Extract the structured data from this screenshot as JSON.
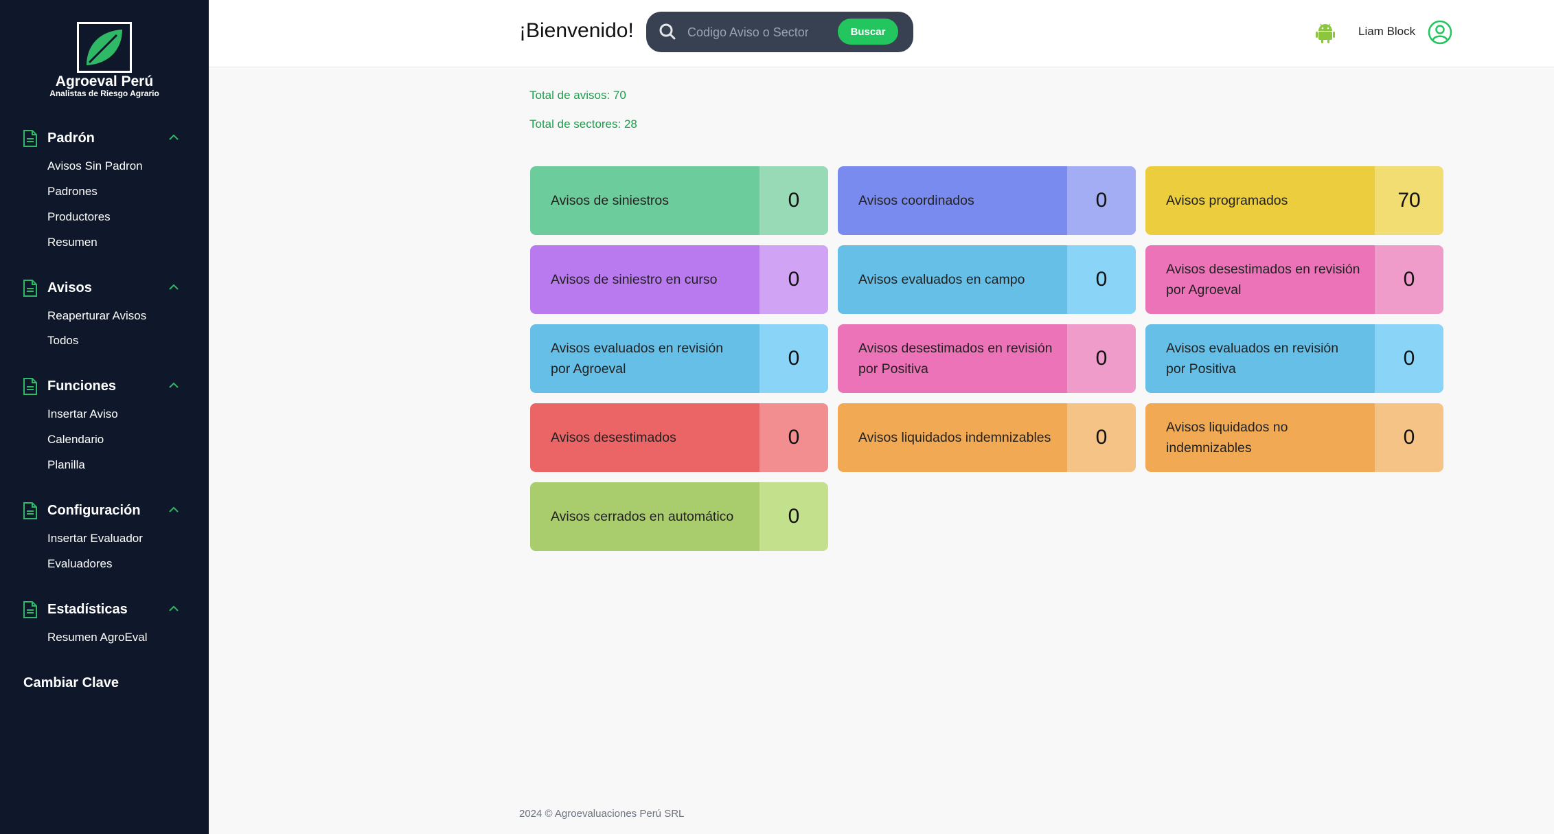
{
  "brand": {
    "name": "Agroeval Perú",
    "tagline": "Analistas de Riesgo Agrario"
  },
  "sidebar": {
    "sections": [
      {
        "title": "Padrón",
        "items": [
          "Avisos Sin Padron",
          "Padrones",
          "Productores",
          "Resumen"
        ]
      },
      {
        "title": "Avisos",
        "items": [
          "Reaperturar Avisos",
          "Todos"
        ]
      },
      {
        "title": "Funciones",
        "items": [
          "Insertar Aviso",
          "Calendario",
          "Planilla"
        ]
      },
      {
        "title": "Configuración",
        "items": [
          "Insertar Evaluador",
          "Evaluadores"
        ]
      },
      {
        "title": "Estadísticas",
        "items": [
          "Resumen AgroEval"
        ]
      }
    ],
    "cambiar_clave": "Cambiar Clave"
  },
  "header": {
    "welcome": "¡Bienvenido!",
    "search_placeholder": "Codigo Aviso o Sector",
    "search_button": "Buscar",
    "user_name": "Liam Block"
  },
  "totals": {
    "avisos": "Total de avisos: 70",
    "sectores": "Total de sectores: 28"
  },
  "cards": [
    {
      "label": "Avisos de siniestros",
      "count": "0",
      "color": "#6dcc9b",
      "count_color": "#98dab6"
    },
    {
      "label": "Avisos coordinados",
      "count": "0",
      "color": "#7a8bef",
      "count_color": "#a2adf4"
    },
    {
      "label": "Avisos programados",
      "count": "70",
      "color": "#eccd3d",
      "count_color": "#f2dd73"
    },
    {
      "label": "Avisos de siniestro en curso",
      "count": "0",
      "color": "#b97aef",
      "count_color": "#d0a3f4"
    },
    {
      "label": "Avisos evaluados en campo",
      "count": "0",
      "color": "#66bfe6",
      "count_color": "#8ad5f7"
    },
    {
      "label": "Avisos desestimados en revisión por Agroeval",
      "count": "0",
      "color": "#ec73b8",
      "count_color": "#f09ccb"
    },
    {
      "label": "Avisos evaluados en revisión por Agroeval",
      "count": "0",
      "color": "#66bfe6",
      "count_color": "#8ad5f7"
    },
    {
      "label": "Avisos desestimados en revisión por Positiva",
      "count": "0",
      "color": "#ec73b8",
      "count_color": "#f09ccb"
    },
    {
      "label": "Avisos evaluados en revisión por Positiva",
      "count": "0",
      "color": "#66bfe6",
      "count_color": "#8ad5f7"
    },
    {
      "label": "Avisos desestimados",
      "count": "0",
      "color": "#eb6466",
      "count_color": "#f28e8f"
    },
    {
      "label": "Avisos liquidados indemnizables",
      "count": "0",
      "color": "#f1a954",
      "count_color": "#f5c386"
    },
    {
      "label": "Avisos liquidados no indemnizables",
      "count": "0",
      "color": "#f1a954",
      "count_color": "#f5c386"
    },
    {
      "label": "Avisos cerrados en automático",
      "count": "0",
      "color": "#a9cc6d",
      "count_color": "#c3e18c"
    }
  ],
  "footer": "2024 © Agroevaluaciones Perú SRL"
}
